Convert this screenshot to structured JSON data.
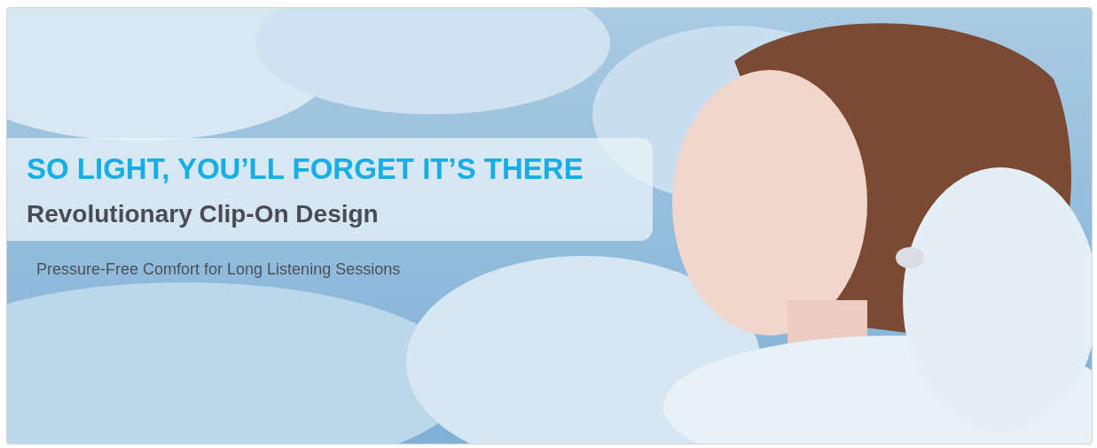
{
  "banner": {
    "headline": "SO LIGHT, YOU’LL FORGET IT’S THERE",
    "subheadline": "Revolutionary Clip-On Design",
    "tagline": "Pressure-Free Comfort for Long Listening Sessions"
  }
}
